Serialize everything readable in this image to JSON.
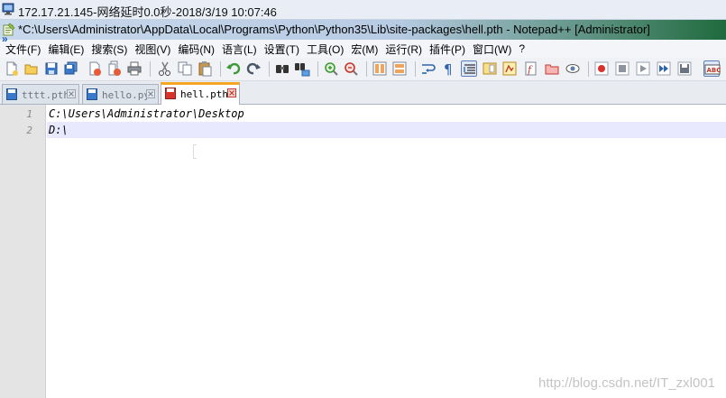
{
  "remote": {
    "status_text": "172.17.21.145-网络延时0.0秒-2018/3/19 10:07:46",
    "collapse_glyph": "»"
  },
  "window": {
    "title": "*C:\\Users\\Administrator\\AppData\\Local\\Programs\\Python\\Python35\\Lib\\site-packages\\hell.pth - Notepad++ [Administrator]"
  },
  "menu": {
    "items": [
      "文件(F)",
      "编辑(E)",
      "搜索(S)",
      "视图(V)",
      "编码(N)",
      "语言(L)",
      "设置(T)",
      "工具(O)",
      "宏(M)",
      "运行(R)",
      "插件(P)",
      "窗口(W)",
      "?"
    ]
  },
  "toolbar": {
    "buttons": [
      "new-file-icon",
      "open-file-icon",
      "save-icon",
      "save-all-icon",
      "close-icon",
      "close-all-icon",
      "print-icon",
      "cut-icon",
      "copy-icon",
      "paste-icon",
      "undo-icon",
      "redo-icon",
      "find-icon",
      "replace-icon",
      "zoom-in-icon",
      "zoom-out-icon",
      "sync-vertical-icon",
      "sync-horizontal-icon",
      "word-wrap-icon",
      "show-all-characters-icon",
      "indent-guide-icon",
      "document-map-icon",
      "function-list-icon",
      "folder-as-workspace-icon",
      "monitoring-icon",
      "record-macro-icon",
      "stop-recording-icon",
      "play-macro-icon",
      "run-macro-multiple-icon",
      "save-macro-icon",
      "spell-check-icon"
    ]
  },
  "tabs": [
    {
      "label": "tttt.pth",
      "active": false,
      "modified": false
    },
    {
      "label": "hello.py",
      "active": false,
      "modified": false
    },
    {
      "label": "hell.pth",
      "active": true,
      "modified": true
    }
  ],
  "editor": {
    "lines": [
      {
        "number": "1",
        "text": "C:\\Users\\Administrator\\Desktop"
      },
      {
        "number": "2",
        "text": "D:\\"
      }
    ],
    "current_line": 2
  },
  "watermark": "http://blog.csdn.net/IT_zxl001",
  "colors": {
    "active_tab_accent": "#f5a623",
    "current_line_highlight": "#e8e8ff",
    "saved_tab_icon": "#3a78c9",
    "modified_tab_icon": "#d9322b"
  }
}
